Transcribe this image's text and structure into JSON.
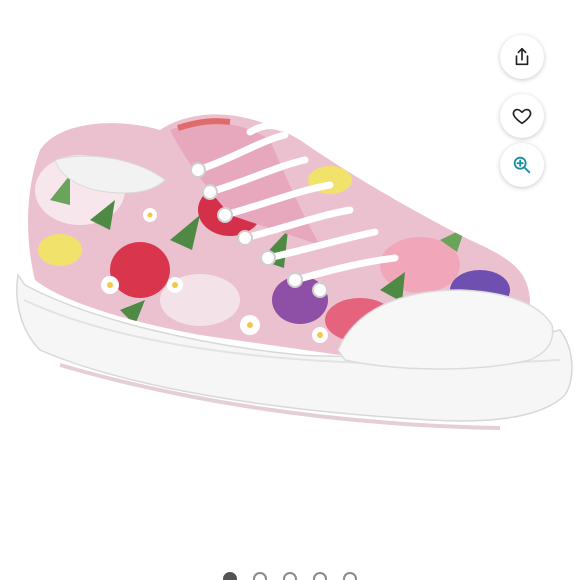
{
  "product_image": {
    "icon": "floral-sneaker-image",
    "colors": {
      "canvas_pink": "#e9b7c6",
      "rose_red": "#d9364e",
      "leaf_green": "#4e8a44",
      "sole_white": "#f4f4f4",
      "lace_white": "#ffffff"
    }
  },
  "actions": {
    "share": {
      "icon": "share-icon"
    },
    "like": {
      "icon": "heart-icon"
    },
    "zoom": {
      "icon": "zoom-in-icon",
      "accent": "#1a8fa0"
    }
  },
  "carousel": {
    "total": 5,
    "active_index": 0
  }
}
